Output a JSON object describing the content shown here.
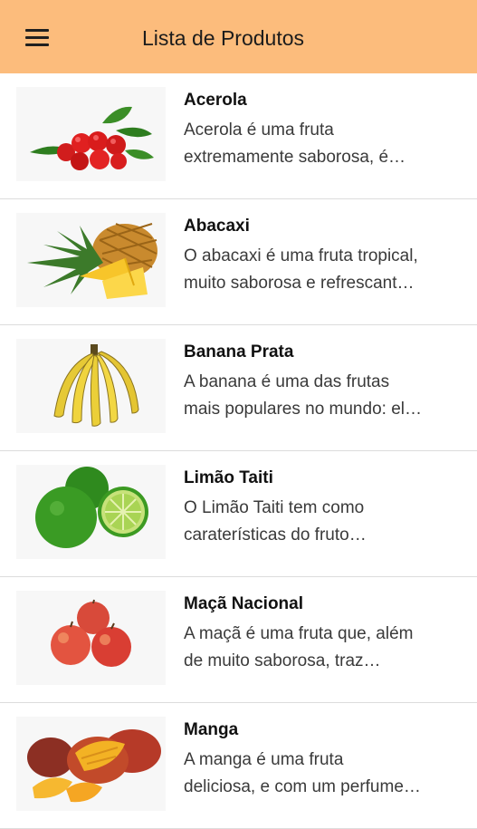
{
  "app_bar": {
    "title": "Lista de Produtos",
    "menu_icon": "hamburger-menu-icon",
    "color": "#fcbc7c"
  },
  "products": [
    {
      "name": "Acerola",
      "desc_line1": "Acerola é uma fruta",
      "desc_line2": "extremamente saborosa, é…",
      "image": "acerola"
    },
    {
      "name": "Abacaxi",
      "desc_line1": "O abacaxi é uma fruta tropical,",
      "desc_line2": "muito saborosa e refrescant…",
      "image": "abacaxi"
    },
    {
      "name": "Banana Prata",
      "desc_line1": "A banana é uma das frutas",
      "desc_line2": "mais populares no mundo: el…",
      "image": "banana"
    },
    {
      "name": "Limão Taiti",
      "desc_line1": "O Limão Taiti tem como",
      "desc_line2": "caraterísticas do fruto…",
      "image": "limao"
    },
    {
      "name": "Maçã Nacional",
      "desc_line1": "A maçã é uma fruta que, além",
      "desc_line2": "de muito saborosa, traz…",
      "image": "maca"
    },
    {
      "name": "Manga",
      "desc_line1": "A manga é uma fruta",
      "desc_line2": "deliciosa, e com um perfume…",
      "image": "manga"
    }
  ]
}
